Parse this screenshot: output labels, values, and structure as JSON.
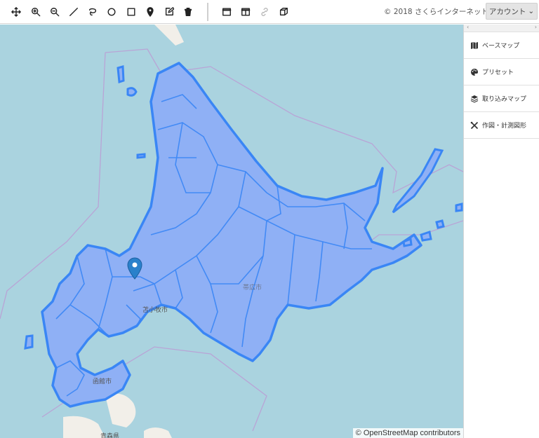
{
  "toolbar": {
    "tools": [
      {
        "name": "move-icon"
      },
      {
        "name": "zoom-in-icon"
      },
      {
        "name": "zoom-out-icon"
      },
      {
        "name": "line-icon"
      },
      {
        "name": "lasso-icon"
      },
      {
        "name": "circle-icon"
      },
      {
        "name": "rectangle-icon"
      },
      {
        "name": "marker-icon"
      },
      {
        "name": "edit-icon"
      },
      {
        "name": "trash-icon"
      }
    ],
    "view_tools": [
      {
        "name": "window-icon"
      },
      {
        "name": "split-view-icon"
      },
      {
        "name": "link-icon"
      },
      {
        "name": "3d-box-icon"
      }
    ],
    "copyright": "© 2018 さくらインターネット",
    "account_label": "アカウント",
    "account_caret": "⌄"
  },
  "map": {
    "attribution": "© OpenStreetMap contributors",
    "labels": {
      "tomakomai": "苫小牧市",
      "hakodate": "函館市",
      "aomori": "青森県",
      "obihiro": "帯広市"
    },
    "colors": {
      "water": "#aad3df",
      "region_fill": "#8fb0f5",
      "region_stroke": "#3a86f5",
      "land": "#f2efe9",
      "marker": "#2a81cb"
    }
  },
  "panel": {
    "head_left": "‹",
    "head_right": "›",
    "items": [
      {
        "label": "ベースマップ",
        "icon": "map-icon"
      },
      {
        "label": "プリセット",
        "icon": "palette-icon"
      },
      {
        "label": "取り込みマップ",
        "icon": "layers-icon"
      },
      {
        "label": "作図・計測図形",
        "icon": "tools-icon"
      }
    ]
  }
}
